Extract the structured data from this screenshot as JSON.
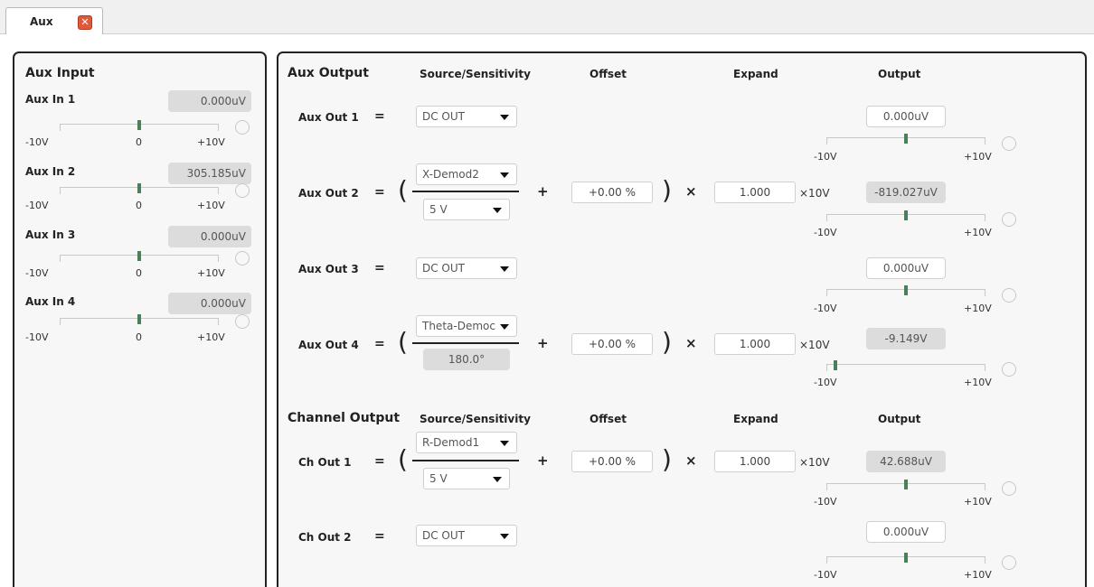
{
  "tab": {
    "label": "Aux",
    "close_glyph": "✕"
  },
  "aux_input": {
    "title": "Aux Input",
    "scale": {
      "min": "-10V",
      "mid": "0",
      "max": "+10V"
    },
    "items": [
      {
        "label": "Aux In 1",
        "value": "0.000uV",
        "level": 0.5
      },
      {
        "label": "Aux In 2",
        "value": "305.185uV",
        "level": 0.5
      },
      {
        "label": "Aux In 3",
        "value": "0.000uV",
        "level": 0.5
      },
      {
        "label": "Aux In 4",
        "value": "0.000uV",
        "level": 0.5
      }
    ]
  },
  "aux_output": {
    "title": "Aux Output",
    "headers": {
      "source": "Source/Sensitivity",
      "offset": "Offset",
      "expand": "Expand",
      "output": "Output"
    },
    "scale": {
      "min": "-10V",
      "max": "+10V"
    },
    "rows": [
      {
        "label": "Aux Out 1",
        "eq": "=",
        "source": "DC OUT",
        "output": "0.000uV",
        "level": 0.5
      },
      {
        "label": "Aux Out 2",
        "eq": "=",
        "source": "X-Demod2",
        "sensitivity": "5 V",
        "plus": "+",
        "offset": "+0.00 %",
        "times": "×",
        "expand": "1.000",
        "expand_unit": "×10V",
        "output": "-819.027uV",
        "level": 0.5
      },
      {
        "label": "Aux Out 3",
        "eq": "=",
        "source": "DC OUT",
        "output": "0.000uV",
        "level": 0.5
      },
      {
        "label": "Aux Out 4",
        "eq": "=",
        "source": "Theta-Demoс",
        "sensitivity": "180.0°",
        "plus": "+",
        "offset": "+0.00 %",
        "times": "×",
        "expand": "1.000",
        "expand_unit": "×10V",
        "output": "-9.149V",
        "level": 0.05
      }
    ]
  },
  "channel_output": {
    "title": "Channel Output",
    "headers": {
      "source": "Source/Sensitivity",
      "offset": "Offset",
      "expand": "Expand",
      "output": "Output"
    },
    "rows": [
      {
        "label": "Ch Out 1",
        "eq": "=",
        "source": "R-Demod1",
        "sensitivity": "5 V",
        "plus": "+",
        "offset": "+0.00 %",
        "times": "×",
        "expand": "1.000",
        "expand_unit": "×10V",
        "output": "42.688uV",
        "level": 0.5
      },
      {
        "label": "Ch Out 2",
        "eq": "=",
        "source": "DC OUT",
        "output": "0.000uV",
        "level": 0.5
      }
    ]
  },
  "colors": {
    "marker": "#4a7f5a",
    "panel_border": "#222222",
    "readout_bg": "#dcdcdc",
    "close_button": "#e05a3a"
  }
}
